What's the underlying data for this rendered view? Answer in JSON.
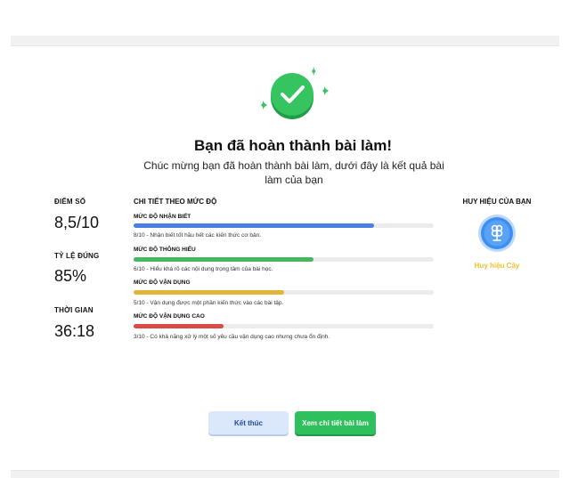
{
  "header": {
    "title": "Bạn đã hoàn thành bài làm!",
    "subtitle": "Chúc mừng bạn đã hoàn thành bài làm, dưới đây là kết quả bài làm của bạn"
  },
  "stats": [
    {
      "label": "ĐIỂM SỐ",
      "value": "8,5/10"
    },
    {
      "label": "TỶ LỆ ĐÚNG",
      "value": "85%"
    },
    {
      "label": "THỜI GIAN",
      "value": "36:18"
    }
  ],
  "details": {
    "title": "CHI TIẾT THEO MỨC ĐỘ",
    "levels": [
      {
        "label": "MỨC ĐỘ NHẬN BIẾT",
        "score": 8,
        "max": 10,
        "color": "#4a7fe0",
        "description": "8/10 - Nhận biết tốt hầu hết các kiến thức cơ bản."
      },
      {
        "label": "MỨC ĐỘ THÔNG HIỂU",
        "score": 6,
        "max": 10,
        "color": "#43b85c",
        "description": "6/10 - Hiểu khá rõ các nội dung trọng tâm của bài học."
      },
      {
        "label": "MỨC ĐỘ VẬN DỤNG",
        "score": 5,
        "max": 10,
        "color": "#e3b43a",
        "description": "5/10 - Vận dụng được một phần kiến thức vào các bài tập."
      },
      {
        "label": "MỨC ĐỘ VẬN DỤNG CAO",
        "score": 3,
        "max": 10,
        "color": "#d94b45",
        "description": "3/10 - Có khả năng xử lý một số yêu cầu vận dụng cao nhưng chưa ổn định."
      }
    ]
  },
  "badge": {
    "title": "HUY HIỆU CỦA BẠN",
    "name": "Huy hiệu Cây",
    "icon": "tree-badge-icon"
  },
  "actions": {
    "end_label": "Kết thúc",
    "detail_label": "Xem chi tiết bài làm"
  },
  "colors": {
    "success_green": "#2ec05c",
    "badge_blue": "#3d8ef0",
    "badge_gold": "#f0c22b"
  }
}
